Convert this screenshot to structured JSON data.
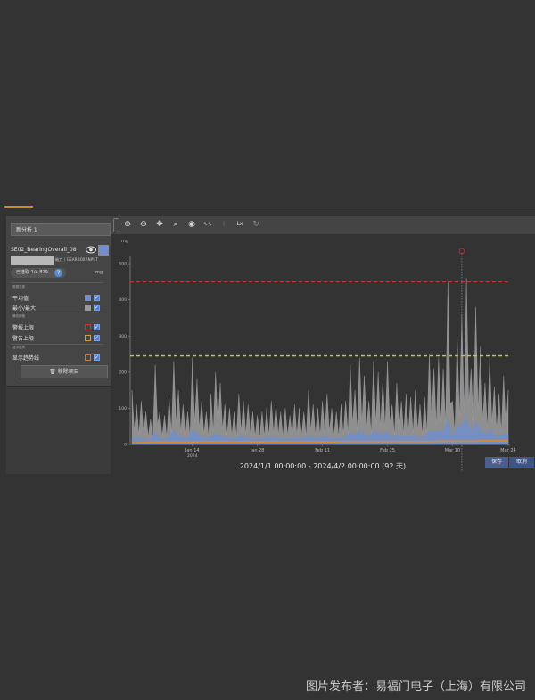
{
  "left_panel": {
    "analysis_title": "新分析 1",
    "sensor_name": "SE02_BearingOverall_08",
    "sensor_path": "磁力 / GEARBOX INPUT",
    "selected_count": "已选取 1/4,829",
    "info": "?",
    "unit": "mg",
    "section_stats": "数据汇报",
    "avg_label": "平均值",
    "minmax_label": "最小/最大",
    "section_static": "静态阈值",
    "alarm_upper": "警报上限",
    "warn_upper": "警告上限",
    "section_display": "显示选项",
    "show_trend": "显示趋势线",
    "remove_item": "移除项目",
    "colors": {
      "avg": "#6f8fd0",
      "minmax": "#9a9a9a",
      "alarm": "#d03030",
      "warn": "#c8a23a",
      "trend": "#c97a3a"
    }
  },
  "toolbar": {
    "icons": [
      "zoom-in-icon",
      "zoom-out-icon",
      "pan-icon",
      "search-icon",
      "eye-icon",
      "waveform-icon",
      "spectrum-icon",
      "lx-icon",
      "refresh-icon"
    ]
  },
  "chart_data": {
    "type": "line",
    "ylabel": "mg",
    "ylim": [
      0,
      520
    ],
    "yticks": [
      "500",
      "400",
      "300",
      "200",
      "100",
      "0"
    ],
    "xticks": [
      "Jan 14",
      "Jan 28",
      "Feb 11",
      "Feb 25",
      "Mar 10",
      "Mar 24"
    ],
    "xticks_sub": [
      "2024",
      "",
      "",
      "",
      "",
      ""
    ],
    "thresholds": [
      {
        "name": "警报上限",
        "value": 450,
        "color": "#d03030"
      },
      {
        "name": "警告上限",
        "value": 245,
        "color": "#d6c72a"
      }
    ],
    "series": [
      {
        "name": "最小/最大",
        "color": "#a0a0a0",
        "values": [
          150,
          110,
          120,
          90,
          70,
          220,
          90,
          80,
          130,
          230,
          150,
          110,
          90,
          240,
          180,
          120,
          90,
          140,
          200,
          170,
          110,
          100,
          90,
          140,
          120,
          110,
          90,
          80,
          90,
          100,
          120,
          110,
          90,
          100,
          80,
          110,
          100,
          90,
          150,
          110,
          100,
          120,
          140,
          100,
          90,
          110,
          120,
          220,
          150,
          240,
          190,
          120,
          230,
          200,
          180,
          230,
          110,
          170,
          120,
          140,
          130,
          150,
          110,
          130,
          250,
          210,
          240,
          210,
          450,
          120,
          300,
          360,
          460,
          210,
          380,
          270,
          170,
          240,
          160,
          140,
          190,
          150
        ]
      },
      {
        "name": "平均值",
        "color": "#6f8fd0",
        "values": [
          20,
          15,
          18,
          14,
          12,
          35,
          15,
          14,
          20,
          40,
          25,
          18,
          15,
          40,
          30,
          20,
          15,
          22,
          30,
          25,
          18,
          16,
          15,
          22,
          20,
          18,
          15,
          14,
          15,
          16,
          20,
          18,
          15,
          16,
          14,
          18,
          16,
          15,
          24,
          18,
          16,
          20,
          22,
          16,
          15,
          18,
          20,
          35,
          24,
          40,
          30,
          20,
          38,
          32,
          28,
          36,
          18,
          28,
          20,
          22,
          21,
          24,
          18,
          21,
          40,
          34,
          38,
          34,
          70,
          20,
          48,
          55,
          72,
          34,
          60,
          44,
          28,
          40,
          26,
          22,
          30,
          25
        ]
      },
      {
        "name": "显示趋势线",
        "color": "#d08a3a",
        "values": [
          5,
          5,
          5,
          5,
          6,
          6,
          6,
          6,
          6,
          6,
          6,
          6,
          6,
          6,
          7,
          7,
          7,
          7,
          7,
          7,
          7,
          7,
          7,
          7,
          7,
          7,
          7,
          7,
          7,
          7,
          7,
          7,
          7,
          7,
          7,
          7,
          7,
          7,
          7,
          7,
          7,
          7,
          7,
          7,
          7,
          8,
          8,
          8,
          8,
          8,
          8,
          8,
          8,
          8,
          8,
          8,
          8,
          8,
          8,
          8,
          8,
          8,
          8,
          8,
          8,
          8,
          9,
          9,
          9,
          9,
          9,
          9,
          9,
          9,
          9,
          10,
          10,
          10,
          10,
          10,
          10,
          10
        ]
      }
    ]
  },
  "footer_range": "2024/1/1 00:00:00 - 2024/4/2 00:00:00 (92 天)",
  "buttons": {
    "save": "保存",
    "cancel": "取消"
  },
  "footer_credit": "图片发布者：易福门电子（上海）有限公司"
}
